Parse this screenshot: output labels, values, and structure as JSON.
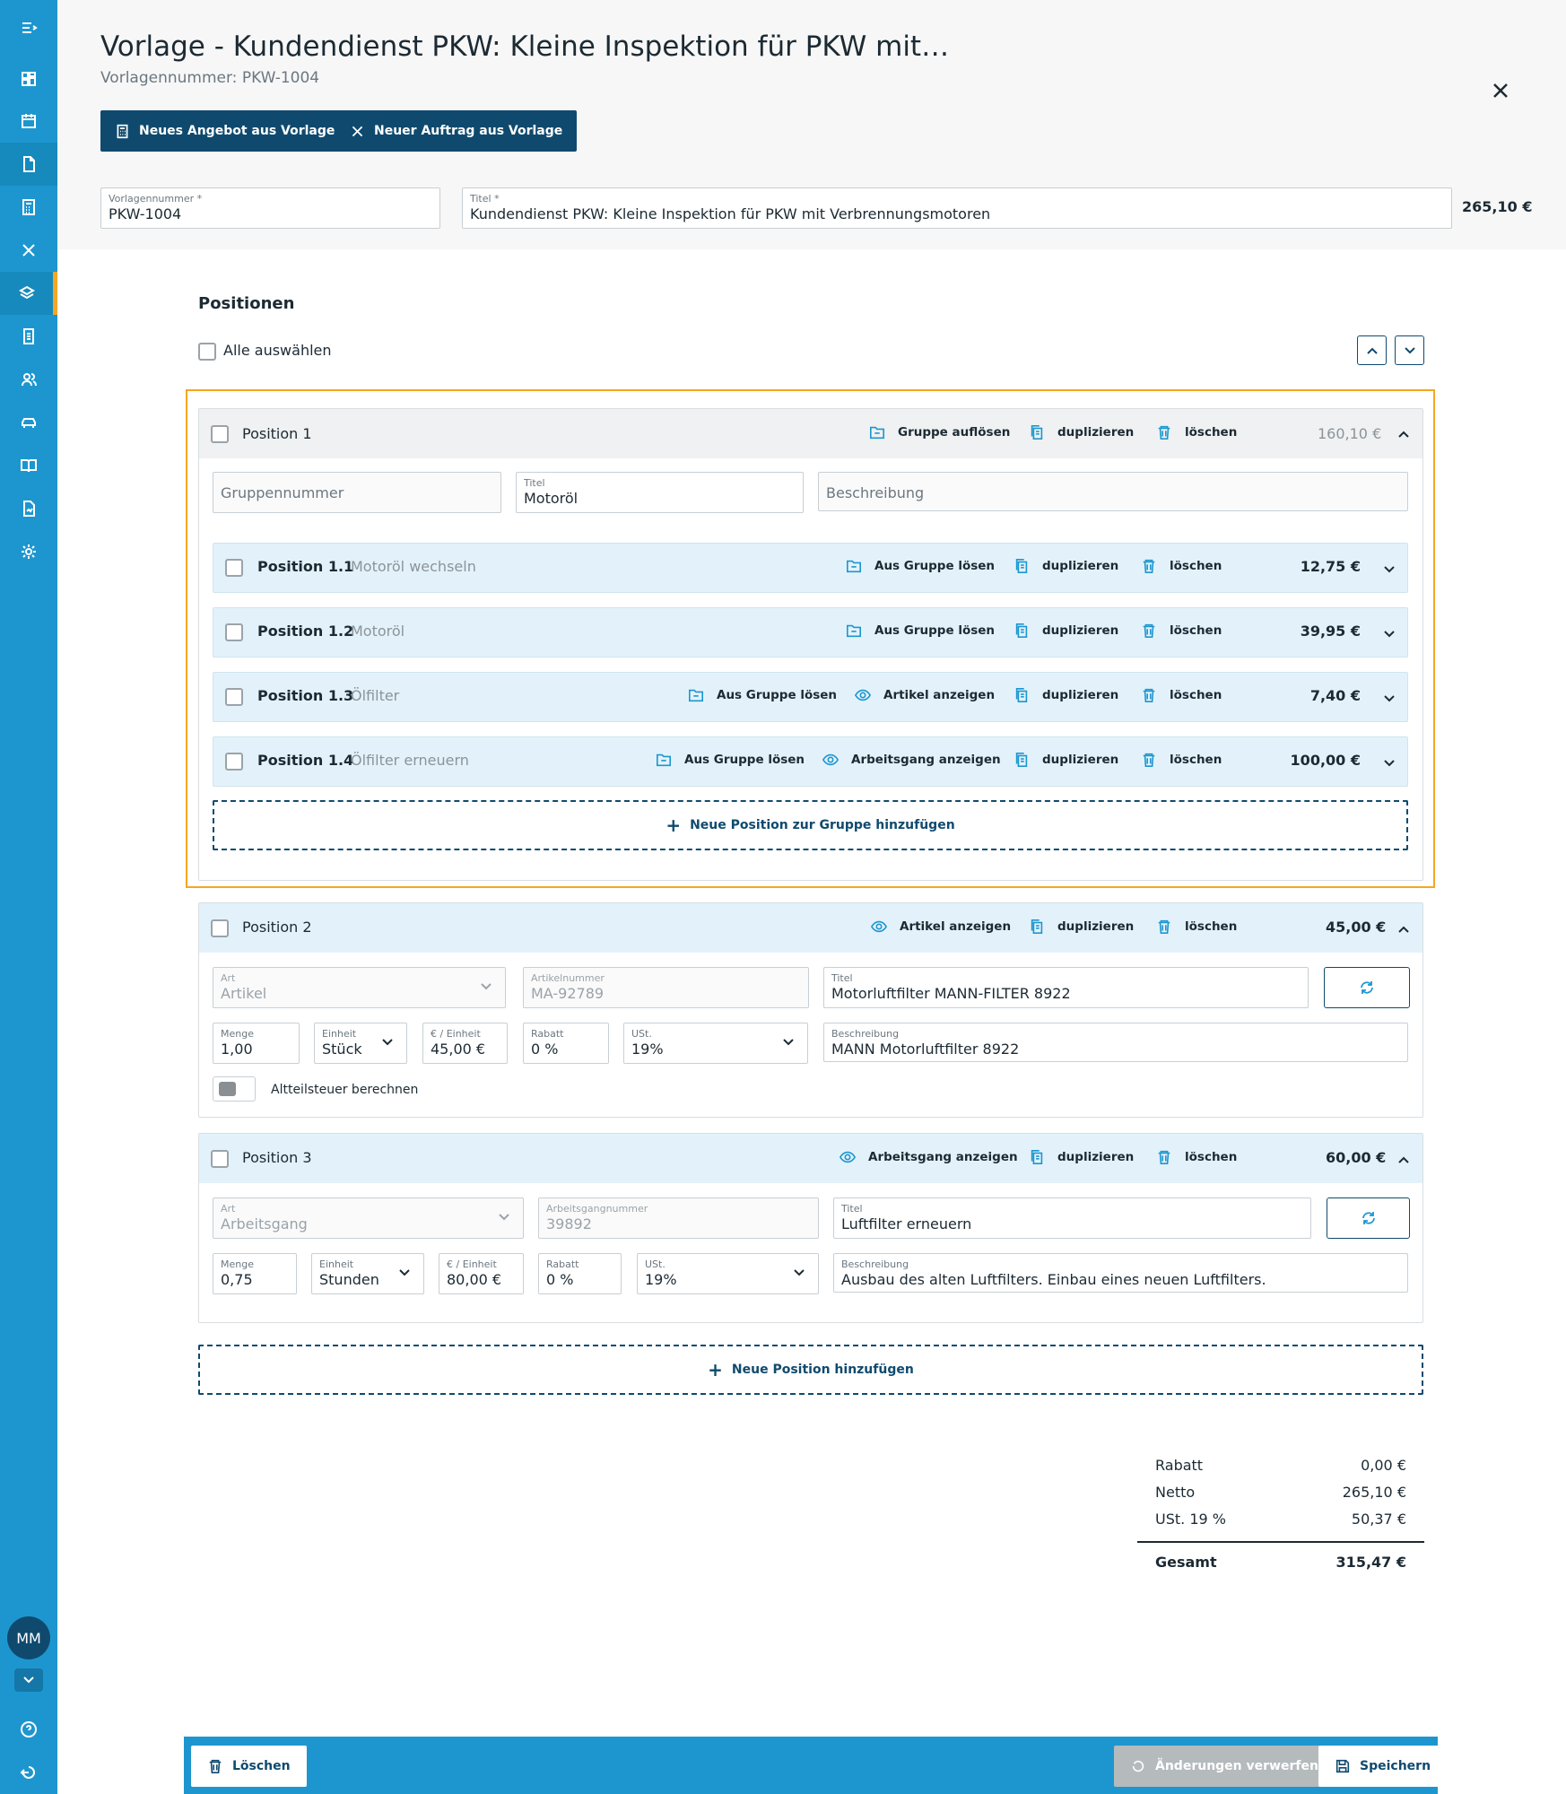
{
  "sidebar": {
    "icons": [
      "menu-toggle-icon",
      "dashboard-icon",
      "calendar-icon",
      "document-icon",
      "calculator-icon",
      "tools-icon",
      "layers-icon",
      "invoice-icon",
      "customers-icon",
      "car-icon",
      "book-icon",
      "report-icon",
      "settings-icon"
    ],
    "avatar_initials": "MM",
    "accent": "#1d96cf",
    "active_marker": "#f5a623"
  },
  "header": {
    "title": "Vorlage - Kundendienst PKW: Kleine Inspektion für PKW mit…",
    "subtitle": "Vorlagennummer: PKW-1004",
    "btn_offer": "Neues Angebot aus Vorlage",
    "btn_order": "Neuer Auftrag aus Vorlage",
    "field_number": {
      "label": "Vorlagennummer *",
      "value": "PKW-1004"
    },
    "field_title": {
      "label": "Titel *",
      "value": "Kundendienst PKW: Kleine Inspektion für PKW mit Verbrennungsmotoren"
    },
    "total": "265,10 €"
  },
  "positions": {
    "title": "Positionen",
    "select_all": "Alle auswählen",
    "group1": {
      "label": "Position 1",
      "act_ungroup": "Gruppe auflösen",
      "act_dup": "duplizieren",
      "act_del": "löschen",
      "price": "160,10 €",
      "f_groupnum_ph": "Gruppennummer",
      "f_title": {
        "label": "Titel",
        "value": "Motoröl"
      },
      "f_desc_ph": "Beschreibung",
      "subs": [
        {
          "label": "Position 1.1",
          "desc": "Motoröl wechseln",
          "price": "12,75 €"
        },
        {
          "label": "Position 1.2",
          "desc": "Motoröl",
          "price": "39,95 €"
        },
        {
          "label": "Position 1.3",
          "desc": "Ölfilter",
          "extra": "Artikel anzeigen",
          "price": "7,40 €"
        },
        {
          "label": "Position 1.4",
          "desc": "Ölfilter erneuern",
          "extra": "Arbeitsgang anzeigen",
          "price": "100,00 €"
        }
      ],
      "sub_act_remove": "Aus Gruppe lösen",
      "sub_act_dup": "duplizieren",
      "sub_act_del": "löschen",
      "add_to_group": "Neue Position zur Gruppe hinzufügen"
    },
    "pos2": {
      "label": "Position 2",
      "act_view": "Artikel anzeigen",
      "act_dup": "duplizieren",
      "act_del": "löschen",
      "price": "45,00 €",
      "art": {
        "label": "Art",
        "value": "Artikel"
      },
      "num": {
        "label": "Artikelnummer",
        "value": "MA-92789"
      },
      "title": {
        "label": "Titel",
        "value": "Motorluftfilter MANN-FILTER 8922"
      },
      "qty": {
        "label": "Menge",
        "value": "1,00"
      },
      "unit": {
        "label": "Einheit",
        "value": "Stück"
      },
      "ppu": {
        "label": "€ / Einheit",
        "value": "45,00 €"
      },
      "disc": {
        "label": "Rabatt",
        "value": "0 %"
      },
      "vat": {
        "label": "USt.",
        "value": "19%"
      },
      "desc": {
        "label": "Beschreibung",
        "value": "MANN Motorluftfilter 8922"
      },
      "toggle_label": "Altteilsteuer berechnen"
    },
    "pos3": {
      "label": "Position 3",
      "act_view": "Arbeitsgang anzeigen",
      "act_dup": "duplizieren",
      "act_del": "löschen",
      "price": "60,00 €",
      "art": {
        "label": "Art",
        "value": "Arbeitsgang"
      },
      "num": {
        "label": "Arbeitsgangnummer",
        "value": "39892"
      },
      "title": {
        "label": "Titel",
        "value": "Luftfilter erneuern"
      },
      "qty": {
        "label": "Menge",
        "value": "0,75"
      },
      "unit": {
        "label": "Einheit",
        "value": "Stunden"
      },
      "ppu": {
        "label": "€ / Einheit",
        "value": "80,00 €"
      },
      "disc": {
        "label": "Rabatt",
        "value": "0 %"
      },
      "vat": {
        "label": "USt.",
        "value": "19%"
      },
      "desc": {
        "label": "Beschreibung",
        "value": "Ausbau des alten Luftfilters. Einbau eines neuen Luftfilters."
      }
    },
    "add_position": "Neue Position hinzufügen"
  },
  "summary": {
    "discount": {
      "label": "Rabatt",
      "value": "0,00 €"
    },
    "net": {
      "label": "Netto",
      "value": "265,10 €"
    },
    "vat": {
      "label": "USt. 19 %",
      "value": "50,37 €"
    },
    "total": {
      "label": "Gesamt",
      "value": "315,47 €"
    }
  },
  "footer": {
    "delete": "Löschen",
    "discard": "Änderungen verwerfen",
    "save": "Speichern"
  }
}
